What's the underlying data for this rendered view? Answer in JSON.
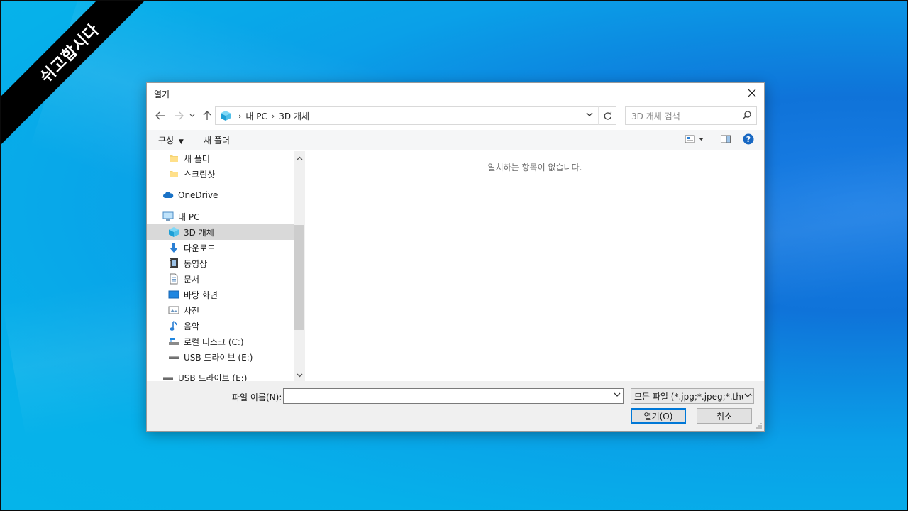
{
  "banner": {
    "text": "쉬고합시다"
  },
  "dialog": {
    "title": "열기",
    "address": {
      "segments": [
        "내 PC",
        "3D 개체"
      ]
    },
    "search_placeholder": "3D 개체 검색",
    "toolbar": {
      "organize": "구성",
      "new_folder": "새 폴더"
    },
    "nav_items": [
      {
        "label": "새 폴더",
        "icon": "folder-icon"
      },
      {
        "label": "스크린샷",
        "icon": "folder-icon"
      },
      {
        "label": "OneDrive",
        "icon": "cloud-icon"
      },
      {
        "label": "내 PC",
        "icon": "computer-icon"
      },
      {
        "label": "3D 개체",
        "icon": "3d-objects-icon",
        "selected": true
      },
      {
        "label": "다운로드",
        "icon": "download-icon"
      },
      {
        "label": "동영상",
        "icon": "video-icon"
      },
      {
        "label": "문서",
        "icon": "document-icon"
      },
      {
        "label": "바탕 화면",
        "icon": "desktop-icon"
      },
      {
        "label": "사진",
        "icon": "picture-icon"
      },
      {
        "label": "음악",
        "icon": "music-icon"
      },
      {
        "label": "로컬 디스크 (C:)",
        "icon": "local-disk-icon"
      },
      {
        "label": "USB 드라이브 (E:)",
        "icon": "usb-drive-icon"
      },
      {
        "label": "USB 드라이브 (E:)",
        "icon": "usb-drive-icon"
      }
    ],
    "empty_message": "일치하는 항목이 없습니다.",
    "filename_label": "파일 이름(N):",
    "filename_value": "",
    "file_type": "모든 파일 (*.jpg;*.jpeg;*.thumb",
    "open_button": "열기(O)",
    "cancel_button": "취소",
    "accent_color": "#0078d7"
  }
}
